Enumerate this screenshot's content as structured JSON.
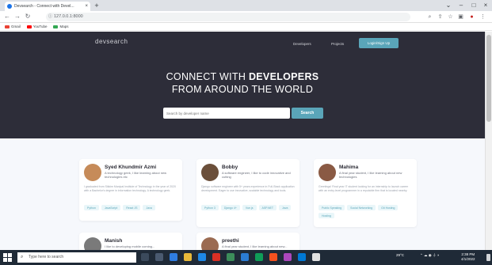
{
  "browser": {
    "tab_title": "Devsearch - Connect with Devel...",
    "tab_close": "×",
    "new_tab": "+",
    "url": "127.0.0.1:8000",
    "bookmarks": [
      {
        "label": "Gmail",
        "color": "#ea4335"
      },
      {
        "label": "YouTube",
        "color": "#ff0000"
      },
      {
        "label": "Maps",
        "color": "#34a853"
      }
    ],
    "window_controls": [
      "⌄",
      "–",
      "□",
      "×"
    ],
    "nav": {
      "back": "←",
      "forward": "→",
      "reload": "↻"
    }
  },
  "site": {
    "logo": "devsearch",
    "nav_links": [
      "Developers",
      "Projects"
    ],
    "login_label": "Login/Sign Up",
    "hero_line1_prefix": "CONNECT WITH",
    "hero_line1_bold": "DEVELOPERS",
    "hero_line2": "FROM AROUND THE WORLD",
    "search_placeholder": "Search by developer name",
    "search_button": "Search"
  },
  "developers": [
    {
      "name": "Syed Khundmir Azmi",
      "role": "A technology geek, I like learning about new technologies etc",
      "bio": "I graduated from Sikkim Manipal Institute of Technology in the year of 2020 with a Bachelor's degree in information technology. A technology geek.",
      "tags": [
        "Python",
        "JavaScript",
        "React JS",
        "Java"
      ],
      "avatar_color": "#c68b59"
    },
    {
      "name": "Bobby",
      "role": "A software engineer, I like to code innovative and cutting",
      "bio": "Django software engineer with 5+ years experience in Full-Stack application development. Eager to use innovative, scalable technology and tools.",
      "tags": [
        "Python 3",
        "Django 4+",
        "Vue.js",
        "ASP.NET",
        "Java"
      ],
      "avatar_color": "#6b4f3a"
    },
    {
      "name": "Mahima",
      "role": "A final year student, I like learning about new technologies",
      "bio": "Greetings! Final year IT student looking for an internship to launch career with an entry-level programmer in a reputable firm that is located nearby.",
      "tags": [
        "Public Speaking",
        "Social Networking",
        "Git Hosting",
        "Hosting"
      ],
      "avatar_color": "#8a5a44"
    },
    {
      "name": "Manish",
      "role": "I like to developing mobile coming...",
      "avatar_color": "#7a7a7a"
    },
    {
      "name": "preethi",
      "role": "A final year student, I like learning about new...",
      "avatar_color": "#9b6b52"
    }
  ],
  "taskbar": {
    "search_placeholder": "Type here to search",
    "weather": "29°C",
    "time": "2:38 PM",
    "date": "4/1/2022"
  },
  "colors": {
    "hero_bg": "#2d2d39",
    "accent": "#5aa5b9",
    "page_bg": "#f6f8fc"
  }
}
